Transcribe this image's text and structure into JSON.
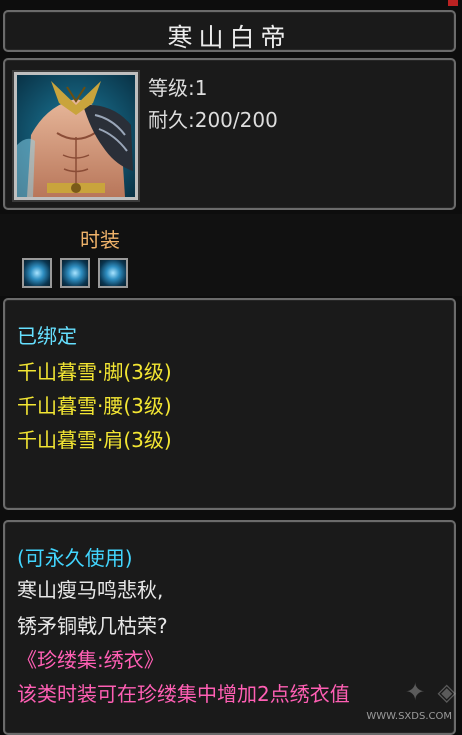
{
  "item": {
    "name": "寒山白帝",
    "level_text": "等级:1",
    "durability_text": "耐久:200/200"
  },
  "fashion": {
    "label": "时装",
    "slots": [
      "fashion-gem",
      "fashion-gem",
      "fashion-gem"
    ]
  },
  "attributes": {
    "bound_text": "已绑定",
    "set_items": [
      "千山暮雪·脚(3级)",
      "千山暮雪·腰(3级)",
      "千山暮雪·肩(3级)"
    ]
  },
  "description": {
    "usage": "(可永久使用)",
    "poem_line1": "寒山瘦马鸣悲秋,",
    "poem_line2": "锈矛铜戟几枯荣?",
    "collection": "《珍缕集:绣衣》",
    "effect": "该类时装可在珍缕集中增加2点绣衣值"
  },
  "watermark": {
    "url": "WWW.SXDS.COM"
  },
  "colors": {
    "bound": "#66e0ff",
    "set_item": "#f3e633",
    "usage": "#42d6ff",
    "effect": "#ff5fb4",
    "fashion_label": "#f0b36a"
  }
}
